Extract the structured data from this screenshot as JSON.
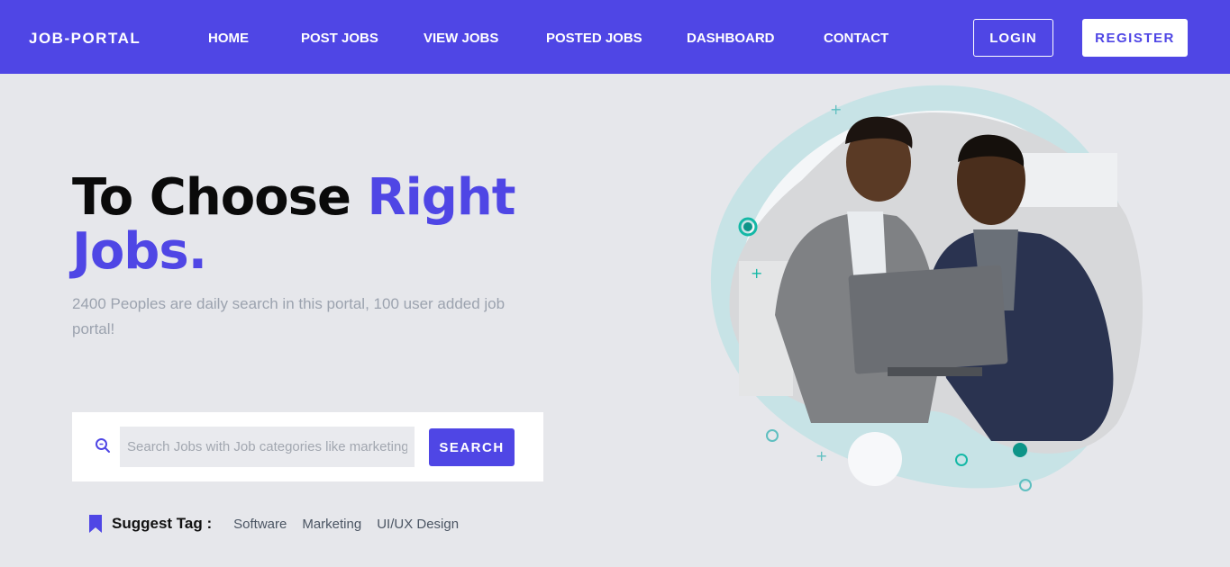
{
  "nav": {
    "brand": "JOB-PORTAL",
    "links": [
      "HOME",
      "POST JOBS",
      "VIEW JOBS",
      "POSTED JOBS",
      "DASHBOARD",
      "CONTACT"
    ],
    "login_label": "LOGIN",
    "register_label": "REGISTER"
  },
  "hero": {
    "title_part1": "To Choose ",
    "title_accent": "Right",
    "title_part2": "Jobs.",
    "subtitle": "2400 Peoples are daily search in this portal, 100 user added job portal!"
  },
  "search": {
    "placeholder": "Search Jobs with Job categories like marketing ...",
    "button_label": "SEARCH"
  },
  "tags": {
    "label": "Suggest Tag :",
    "items": [
      "Software",
      "Marketing",
      "UI/UX Design"
    ]
  },
  "colors": {
    "primary": "#4f46e5",
    "background": "#e6e7eb",
    "accent_teal": "#14b8a6"
  },
  "icons": {
    "search": "search-icon",
    "bookmark": "bookmark-icon"
  }
}
